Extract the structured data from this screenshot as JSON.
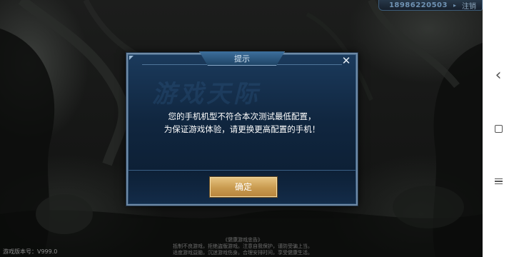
{
  "account": {
    "phone": "18986220503",
    "separator": "▸",
    "logout_label": "注销"
  },
  "dialog": {
    "title": "提示",
    "close_glyph": "✕",
    "watermark": "游戏天际",
    "message_line1": "您的手机机型不符合本次测试最低配置，",
    "message_line2": "为保证游戏体验，请更换更高配置的手机！",
    "confirm_label": "确定"
  },
  "footer": {
    "version": "游戏版本号：V999.0",
    "notice_title": "《健康游戏忠告》",
    "notice_line1": "抵制不良游戏，拒绝盗版游戏。注意自我保护，谨防受骗上当。",
    "notice_line2": "适度游戏益脑，沉迷游戏伤身。合理安排时间，享受健康生活。"
  },
  "nav": {
    "back_glyph": "‹"
  },
  "colors": {
    "dialog_bg": "#10263f",
    "dialog_border": "#6f8aa6",
    "confirm_gold": "#c89a4f",
    "nav_bg": "#ffffff"
  }
}
